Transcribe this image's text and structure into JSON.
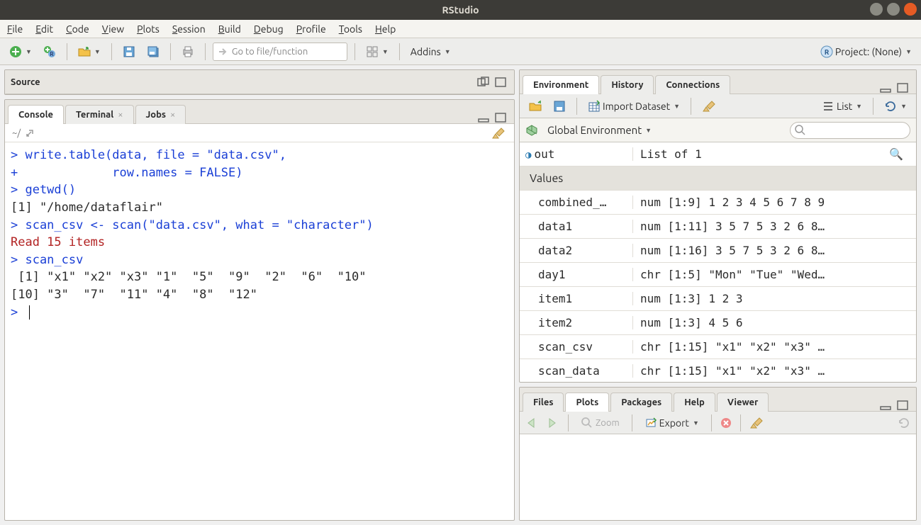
{
  "window": {
    "title": "RStudio"
  },
  "menu": [
    "File",
    "Edit",
    "Code",
    "View",
    "Plots",
    "Session",
    "Build",
    "Debug",
    "Profile",
    "Tools",
    "Help"
  ],
  "toolbar": {
    "goto_placeholder": "Go to file/function",
    "addins": "Addins",
    "project_label": "Project: (None)"
  },
  "left": {
    "source_title": "Source",
    "tabs": {
      "console": "Console",
      "terminal": "Terminal",
      "jobs": "Jobs"
    },
    "console_path": "~/",
    "console_lines": [
      {
        "cls": "c-blue",
        "text": "> write.table(data, file = \"data.csv\","
      },
      {
        "cls": "c-blue",
        "text": "+             row.names = FALSE)"
      },
      {
        "cls": "c-blue",
        "text": "> getwd()"
      },
      {
        "cls": "",
        "text": "[1] \"/home/dataflair\""
      },
      {
        "cls": "c-blue",
        "text": "> scan_csv <- scan(\"data.csv\", what = \"character\")"
      },
      {
        "cls": "c-red",
        "text": "Read 15 items"
      },
      {
        "cls": "c-blue",
        "text": "> scan_csv"
      },
      {
        "cls": "",
        "text": " [1] \"x1\" \"x2\" \"x3\" \"1\"  \"5\"  \"9\"  \"2\"  \"6\"  \"10\""
      },
      {
        "cls": "",
        "text": "[10] \"3\"  \"7\"  \"11\" \"4\"  \"8\"  \"12\""
      }
    ],
    "prompt": "> "
  },
  "env": {
    "tabs": [
      "Environment",
      "History",
      "Connections"
    ],
    "import": "Import Dataset",
    "view_mode": "List",
    "scope": "Global Environment",
    "out_row": {
      "name": "out",
      "value": "List of 1"
    },
    "section": "Values",
    "rows": [
      {
        "name": "combined_…",
        "value": "num [1:9] 1 2 3 4 5 6 7 8 9"
      },
      {
        "name": "data1",
        "value": "num [1:11] 3 5 7 5 3 2 6 8…"
      },
      {
        "name": "data2",
        "value": "num [1:16] 3 5 7 5 3 2 6 8…"
      },
      {
        "name": "day1",
        "value": "chr [1:5] \"Mon\" \"Tue\" \"Wed…"
      },
      {
        "name": "item1",
        "value": "num [1:3] 1 2 3"
      },
      {
        "name": "item2",
        "value": "num [1:3] 4 5 6"
      },
      {
        "name": "scan_csv",
        "value": "chr [1:15] \"x1\" \"x2\" \"x3\" …"
      },
      {
        "name": "scan_data",
        "value": "chr [1:15] \"x1\" \"x2\" \"x3\" …"
      }
    ]
  },
  "plots": {
    "tabs": [
      "Files",
      "Plots",
      "Packages",
      "Help",
      "Viewer"
    ],
    "zoom": "Zoom",
    "export": "Export"
  }
}
